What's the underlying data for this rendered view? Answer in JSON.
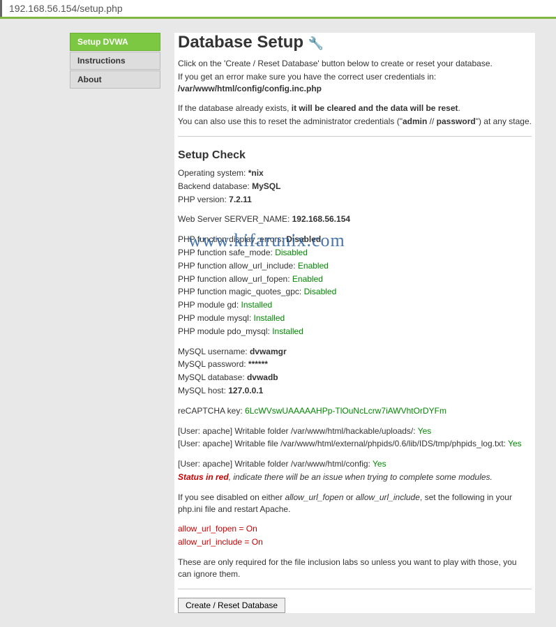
{
  "url": "192.168.56.154/setup.php",
  "sidebar": {
    "items": [
      {
        "label": "Setup DVWA",
        "active": true
      },
      {
        "label": "Instructions",
        "active": false
      },
      {
        "label": "About",
        "active": false
      }
    ]
  },
  "page": {
    "title": "Database Setup",
    "intro1": "Click on the 'Create / Reset Database' button below to create or reset your database.",
    "intro2a": "If you get an error make sure you have the correct user credentials in: ",
    "intro2b": "/var/www/html/config/config.inc.php",
    "intro3a": "If the database already exists, ",
    "intro3b": "it will be cleared and the data will be reset",
    "intro3c": ".",
    "intro4a": "You can also use this to reset the administrator credentials (\"",
    "intro4b": "admin",
    "intro4c": " // ",
    "intro4d": "password",
    "intro4e": "\") at any stage."
  },
  "check": {
    "title": "Setup Check",
    "os_label": "Operating system: ",
    "os_value": "*nix",
    "db_label": "Backend database: ",
    "db_value": "MySQL",
    "php_label": "PHP version: ",
    "php_value": "7.2.11",
    "server_label": "Web Server SERVER_NAME: ",
    "server_value": "192.168.56.154",
    "fn1_label": "PHP function display_errors: ",
    "fn1_value": "Disabled",
    "fn2_label": "PHP function safe_mode: ",
    "fn2_value": "Disabled",
    "fn3_label": "PHP function allow_url_include: ",
    "fn3_value": "Enabled",
    "fn4_label": "PHP function allow_url_fopen: ",
    "fn4_value": "Enabled",
    "fn5_label": "PHP function magic_quotes_gpc: ",
    "fn5_value": "Disabled",
    "mod1_label": "PHP module gd: ",
    "mod1_value": "Installed",
    "mod2_label": "PHP module mysql: ",
    "mod2_value": "Installed",
    "mod3_label": "PHP module pdo_mysql: ",
    "mod3_value": "Installed",
    "my_user_label": "MySQL username: ",
    "my_user_value": "dvwamgr",
    "my_pass_label": "MySQL password: ",
    "my_pass_value": "******",
    "my_db_label": "MySQL database: ",
    "my_db_value": "dvwadb",
    "my_host_label": "MySQL host: ",
    "my_host_value": "127.0.0.1",
    "recaptcha_label": "reCAPTCHA key: ",
    "recaptcha_value": "6LcWVswUAAAAAHPp-TlOuNcLcrw7iAWVhtOrDYFm",
    "w1_label": "[User: apache] Writable folder /var/www/html/hackable/uploads/: ",
    "w1_value": "Yes",
    "w2_label": "[User: apache] Writable file /var/www/html/external/phpids/0.6/lib/IDS/tmp/phpids_log.txt: ",
    "w2_value": "Yes",
    "w3_label": "[User: apache] Writable folder /var/www/html/config: ",
    "w3_value": "Yes",
    "status_red": "Status in red",
    "status_rest": ", indicate there will be an issue when trying to complete some modules.",
    "note1a": "If you see disabled on either ",
    "note1b": "allow_url_fopen",
    "note1c": " or ",
    "note1d": "allow_url_include",
    "note1e": ", set the following in your php.ini file and restart Apache.",
    "ini1": "allow_url_fopen = On",
    "ini2": "allow_url_include = On",
    "note2": "These are only required for the file inclusion labs so unless you want to play with those, you can ignore them."
  },
  "button": {
    "label": "Create / Reset Database"
  },
  "watermark": "www.kifarunix.com"
}
